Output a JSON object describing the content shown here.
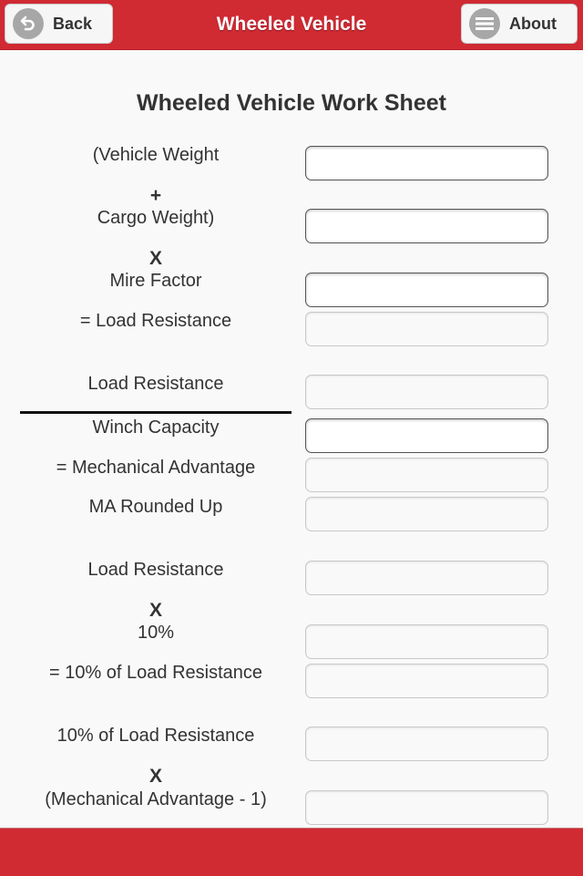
{
  "header": {
    "title": "Wheeled Vehicle",
    "back_label": "Back",
    "about_label": "About",
    "back_icon": "back-arrow-circle-icon",
    "about_icon": "menu-lines-circle-icon",
    "accent_color": "#d02a33"
  },
  "worksheet": {
    "title": "Wheeled Vehicle Work Sheet",
    "labels": {
      "vehicle_weight": "(Vehicle Weight",
      "plus": "+",
      "cargo_weight": "Cargo Weight)",
      "times_1": "X",
      "mire_factor": "Mire Factor",
      "load_resistance_result": "= Load Resistance",
      "load_resistance_2": "Load Resistance",
      "winch_capacity": "Winch Capacity",
      "mechanical_advantage_result": "= Mechanical Advantage",
      "ma_rounded_up": "MA Rounded Up",
      "load_resistance_3": "Load Resistance",
      "times_2": "X",
      "ten_percent": "10%",
      "ten_percent_result": "= 10% of Load Resistance",
      "ten_percent_lr": "10% of Load Resistance",
      "times_3": "X",
      "ma_minus_one": "(Mechanical Advantage - 1)"
    },
    "fields": {
      "vehicle_weight": "",
      "cargo_weight": "",
      "mire_factor": "",
      "load_resistance": "",
      "load_resistance_2": "",
      "winch_capacity": "",
      "mechanical_advantage": "",
      "ma_rounded_up": "",
      "load_resistance_3": "",
      "ten_percent": "",
      "ten_percent_result": "",
      "ten_percent_lr": "",
      "ma_minus_one": ""
    }
  }
}
